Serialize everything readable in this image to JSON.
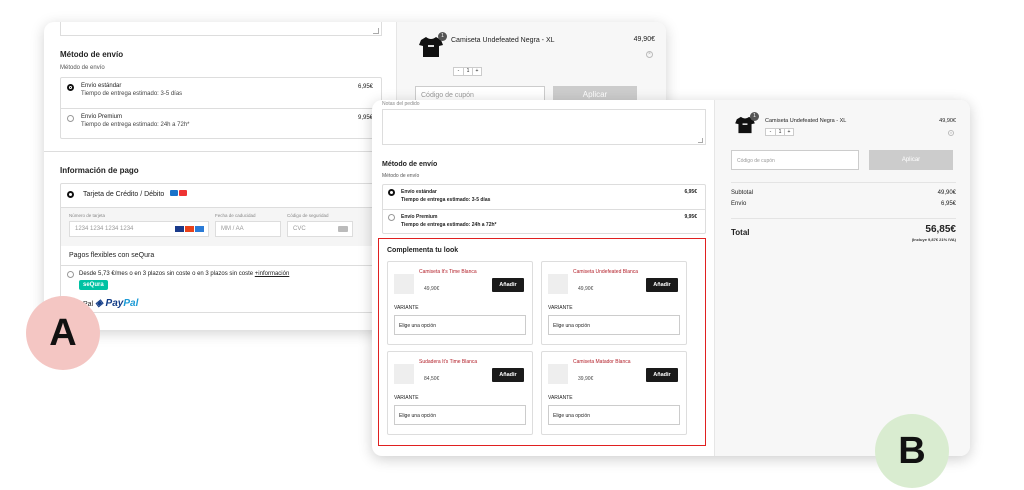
{
  "screenshot_a": {
    "shipping": {
      "heading": "Método de envío",
      "subheading": "Método de envío",
      "options": [
        {
          "name": "Envío estándar",
          "estimate": "Tiempo de entrega estimado: 3-5 días",
          "price": "6,95€",
          "selected": true
        },
        {
          "name": "Envío Premium",
          "estimate": "Tiempo de entrega estimado: 24h a 72h*",
          "price": "9,95€",
          "selected": false
        }
      ]
    },
    "payment": {
      "heading": "Información de pago",
      "card_option": "Tarjeta de Crédito / Débito",
      "card_number_label": "Número de tarjeta",
      "card_number_placeholder": "1234 1234 1234 1234",
      "expiry_label": "Fecha de caducidad",
      "expiry_placeholder": "MM / AA",
      "cvc_label": "Código de seguridad",
      "cvc_placeholder": "CVC",
      "sequra_heading": "Pagos flexibles con seQura",
      "sequra_text": "Desde 5,73 €/mes o en 3 plazos sin coste o en 3 plazos sin coste",
      "sequra_link": "+información",
      "sequra_badge": "seQura",
      "paypal_prefix": "Pal",
      "paypal_brand_a": "Pay",
      "paypal_brand_b": "Pal"
    },
    "cart": {
      "item_name": "Camiseta Undefeated Negra - XL",
      "item_price": "49,90€",
      "item_qty": "1",
      "badge": "1",
      "coupon_placeholder": "Código de cupón",
      "apply_label": "Aplicar"
    }
  },
  "screenshot_b": {
    "notes_label": "Notas del pedido",
    "shipping": {
      "heading": "Método de envío",
      "subheading": "Método de envío",
      "options": [
        {
          "name": "Envío estándar",
          "estimate": "Tiempo de entrega estimado: 3-5 días",
          "price": "6,95€",
          "selected": true
        },
        {
          "name": "Envío Premium",
          "estimate": "Tiempo de entrega estimado: 24h a 72h*",
          "price": "9,95€",
          "selected": false
        }
      ]
    },
    "complement": {
      "title": "Complementa tu look",
      "products": [
        {
          "name": "Camiseta It's Time Blanca",
          "price": "49,90€",
          "add": "Añadir",
          "variant_label": "VARIANTE",
          "select": "Elige una opción"
        },
        {
          "name": "Camiseta Undefeated Blanca",
          "price": "49,90€",
          "add": "Añadir",
          "variant_label": "VARIANTE",
          "select": "Elige una opción"
        },
        {
          "name": "Sudadera It's Time Blanca",
          "price": "84,50€",
          "add": "Añadir",
          "variant_label": "VARIANTE",
          "select": "Elige una opción"
        },
        {
          "name": "Camiseta Matador Blanca",
          "price": "39,90€",
          "add": "Añadir",
          "variant_label": "VARIANTE",
          "select": "Elige una opción"
        }
      ]
    },
    "cart": {
      "item_name": "Camiseta Undefeated Negra - XL",
      "item_price": "49,90€",
      "item_qty": "1",
      "badge": "1",
      "coupon_placeholder": "Código de cupón",
      "apply_label": "Aplicar",
      "subtotal_label": "Subtotal",
      "subtotal_value": "49,90€",
      "shipping_label": "Envío",
      "shipping_value": "6,95€",
      "total_label": "Total",
      "total_value": "56,85€",
      "tax_note": "(Incluye 9,87€ 21% IVA)"
    }
  },
  "labels": {
    "a": "A",
    "b": "B"
  },
  "colors": {
    "accent_red": "#e02020",
    "product_name": "#b3202a",
    "button_dark": "#1a1a1a",
    "label_a_bg": "#f4c6c3",
    "label_b_bg": "#d9ecd0",
    "sequra": "#00c2a3"
  }
}
